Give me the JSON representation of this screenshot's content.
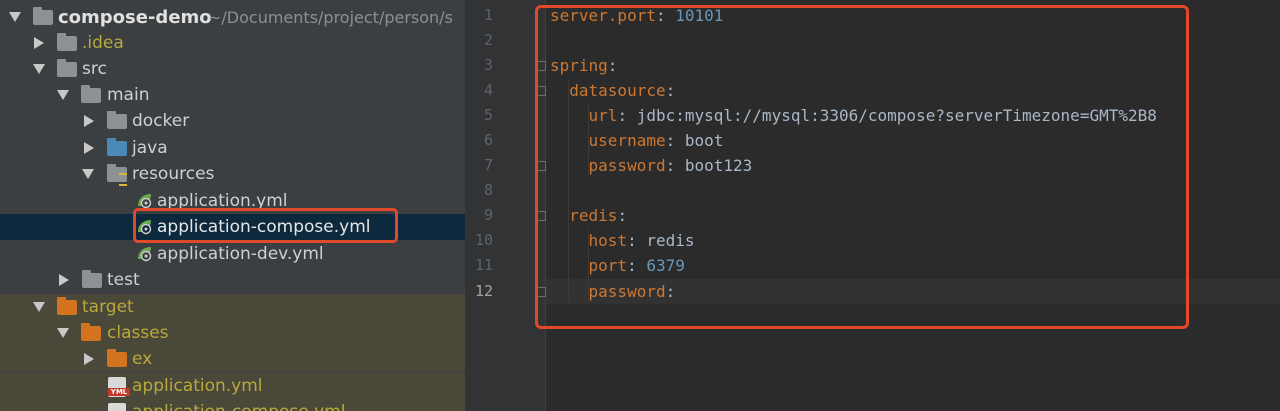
{
  "project": {
    "name": "compose-demo",
    "path": "~/Documents/project/person/s"
  },
  "tree": [
    {
      "label": ".idea",
      "icon": "folder-icon"
    },
    {
      "label": "src",
      "icon": "folder-icon"
    },
    {
      "label": "main",
      "icon": "folder-icon"
    },
    {
      "label": "docker",
      "icon": "folder-icon"
    },
    {
      "label": "java",
      "icon": "source-folder-icon"
    },
    {
      "label": "resources",
      "icon": "resources-folder-icon"
    },
    {
      "label": "application.yml",
      "icon": "spring-config-icon"
    },
    {
      "label": "application-compose.yml",
      "icon": "spring-config-icon"
    },
    {
      "label": "application-dev.yml",
      "icon": "spring-config-icon"
    },
    {
      "label": "test",
      "icon": "folder-icon"
    },
    {
      "label": "target",
      "icon": "excluded-folder-icon"
    },
    {
      "label": "classes",
      "icon": "excluded-folder-icon"
    },
    {
      "label": "ex",
      "icon": "excluded-folder-icon"
    },
    {
      "label": "application.yml",
      "icon": "yml-file-icon"
    },
    {
      "label": "application-compose.yml",
      "icon": "yml-file-icon"
    }
  ],
  "yml_badge": "YML",
  "line_numbers": [
    "1",
    "2",
    "3",
    "4",
    "5",
    "6",
    "7",
    "8",
    "9",
    "10",
    "11",
    "12"
  ],
  "code": {
    "l1_key": "server.port",
    "l1_val": "10101",
    "l3_key": "spring",
    "l4_key": "datasource",
    "l5_key": "url",
    "l5_val": "jdbc:mysql://mysql:3306/compose?serverTimezone=GMT%2B8",
    "l6_key": "username",
    "l6_val": "boot",
    "l7_key": "password",
    "l7_val": "boot123",
    "l9_key": "redis",
    "l10_key": "host",
    "l10_val": "redis",
    "l11_key": "port",
    "l11_val": "6379",
    "l12_key": "password"
  },
  "colors": {
    "highlight": "#e04a2a",
    "yaml_key": "#cc7832",
    "yaml_number": "#6897bb",
    "yaml_text": "#a9b7c6"
  }
}
